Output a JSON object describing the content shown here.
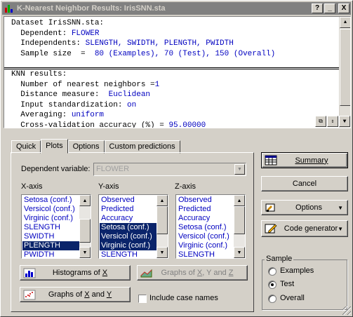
{
  "window": {
    "title": "K-Nearest Neighbor Results: IrisSNN.sta",
    "help_btn": "?",
    "minimize_btn": "_",
    "close_btn": "X"
  },
  "output": {
    "section1": [
      {
        "k": "Dataset IrisSNN.sta:",
        "v": ""
      },
      {
        "k": "  Dependent: ",
        "v": "FLOWER"
      },
      {
        "k": "  Independents: ",
        "v": "SLENGTH, SWIDTH, PLENGTH, PWIDTH"
      },
      {
        "k": "  Sample size  =  ",
        "v": "80 (Examples), 70 (Test), 150 (Overall)"
      }
    ],
    "section2": [
      {
        "k": "KNN results:",
        "v": ""
      },
      {
        "k": "  Number of nearest neighbors =",
        "v": "1"
      },
      {
        "k": "  Distance measure:  ",
        "v": "Euclidean"
      },
      {
        "k": "  Input standardization: ",
        "v": "on"
      },
      {
        "k": "  Averaging: ",
        "v": "uniform"
      },
      {
        "k": "  Cross-validation accuracy (%) = ",
        "v": "95.00000"
      }
    ]
  },
  "tabs": [
    "Quick",
    "Plots",
    "Options",
    "Custom predictions"
  ],
  "active_tab": "Plots",
  "plots": {
    "dependent_label": "Dependent variable:",
    "dependent_value": "FLOWER",
    "xaxis_label": "X-axis",
    "yaxis_label": "Y-axis",
    "zaxis_label": "Z-axis",
    "xaxis_items": [
      "Setosa (conf.)",
      "Versicol (conf.)",
      "Virginic (conf.)",
      "SLENGTH",
      "SWIDTH",
      "PLENGTH",
      "PWIDTH"
    ],
    "xaxis_selected": "PLENGTH",
    "yaxis_items": [
      "Observed",
      "Predicted",
      "Accuracy",
      "Setosa (conf.)",
      "Versicol (conf.)",
      "Virginic (conf.)",
      "SLENGTH"
    ],
    "yaxis_selected": [
      "Setosa (conf.)",
      "Versicol (conf.)",
      "Virginic (conf.)"
    ],
    "zaxis_items": [
      "Observed",
      "Predicted",
      "Accuracy",
      "Setosa (conf.)",
      "Versicol (conf.)",
      "Virginic (conf.)",
      "SLENGTH"
    ],
    "btn_hist_prefix": "Histograms of ",
    "btn_hist_key": "X",
    "btn_graphs_xyz_prefix": "Graphs of ",
    "btn_graphs_xyz_x": "X",
    "btn_graphs_xyz_mid": ", Y and ",
    "btn_graphs_xyz_z": "Z",
    "btn_graphs_xy_prefix": "Graphs of ",
    "btn_graphs_xy_x": "X",
    "btn_graphs_xy_mid": " and ",
    "btn_graphs_xy_y": "Y",
    "include_case_names": "Include case names"
  },
  "right": {
    "summary": "Summary",
    "cancel": "Cancel",
    "options": "Options",
    "code_generator": "Code generator",
    "sample_title": "Sample",
    "sample_options": [
      "Examples",
      "Test",
      "Overall"
    ],
    "sample_selected": "Test"
  }
}
